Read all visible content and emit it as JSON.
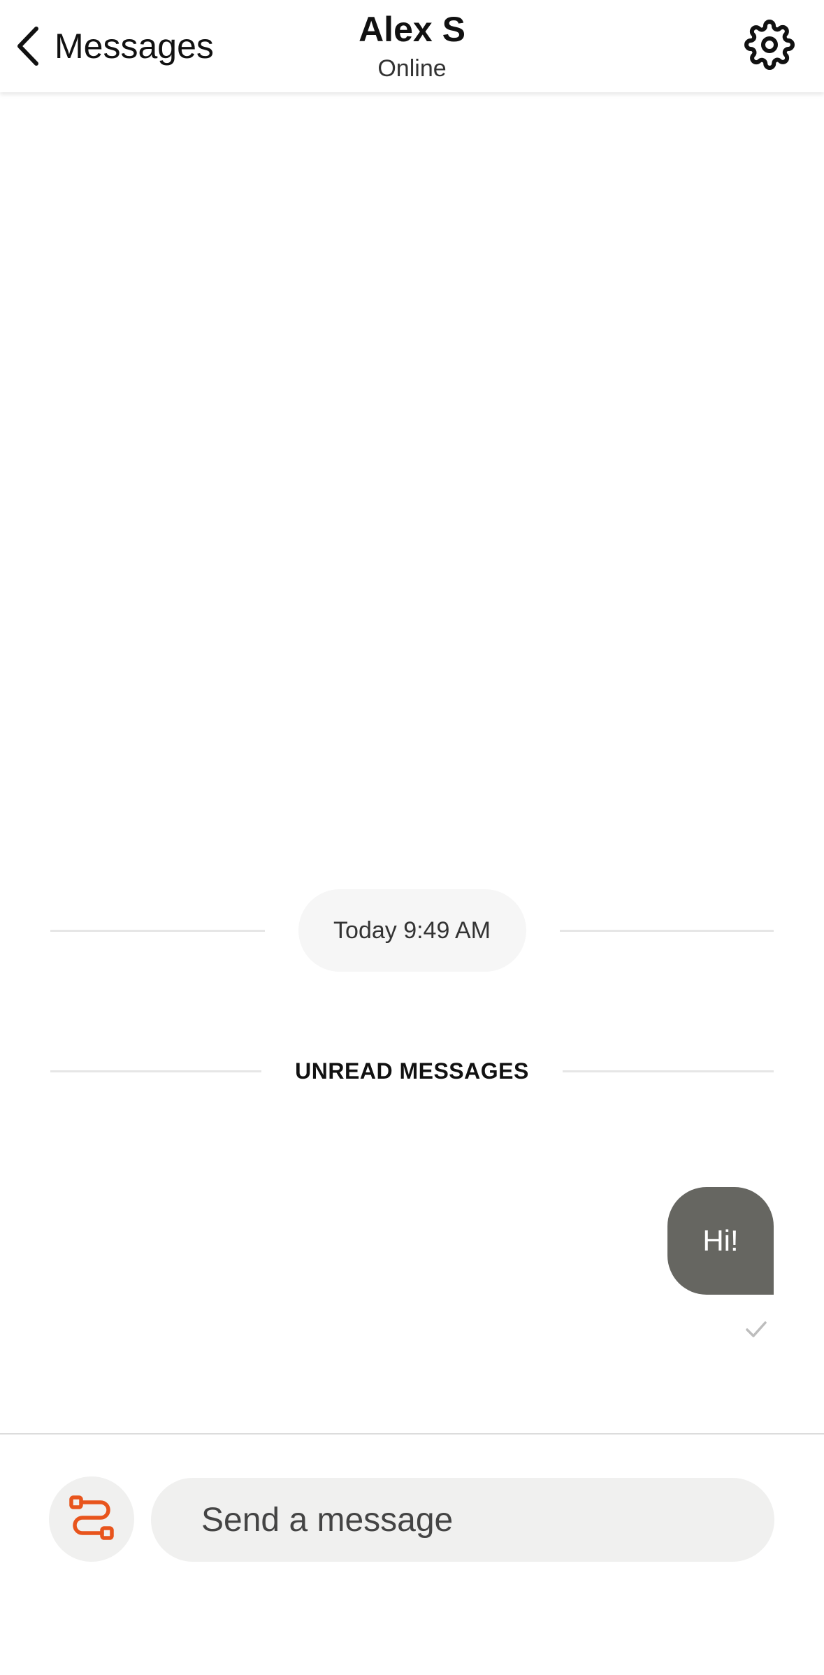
{
  "header": {
    "back_label": "Messages",
    "contact_name": "Alex S",
    "contact_status": "Online",
    "back_icon": "chevron-left-icon",
    "settings_icon": "gear-icon"
  },
  "conversation": {
    "timestamp": "Today 9:49 AM",
    "unread_label": "UNREAD MESSAGES",
    "messages": [
      {
        "text": "Hi!",
        "direction": "outgoing",
        "status_icon": "checkmark-icon"
      }
    ]
  },
  "composer": {
    "placeholder": "Send a message",
    "value": "",
    "quick_action_icon": "route-icon"
  },
  "colors": {
    "accent": "#e8541c",
    "outgoing_bubble": "#666661",
    "input_background": "#f0f0ef",
    "pill_background": "#f6f6f6",
    "divider": "#e6e6e6"
  }
}
